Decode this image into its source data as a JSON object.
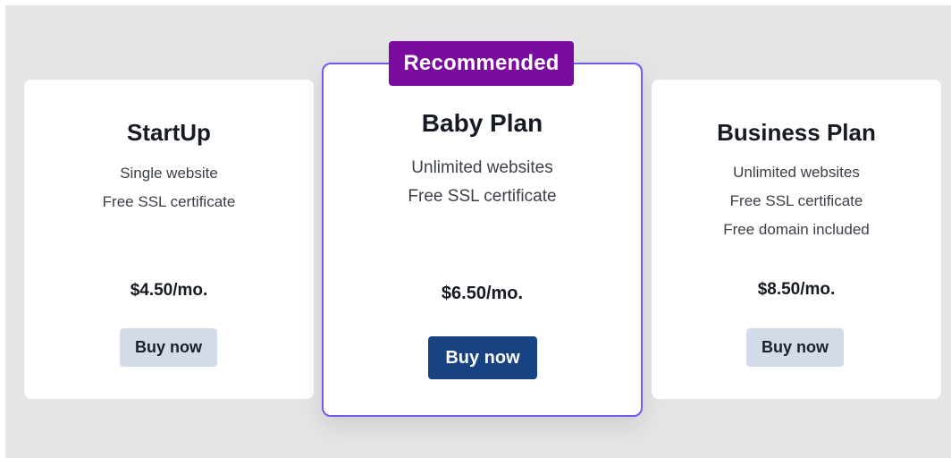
{
  "featured_badge": "Recommended",
  "plans": [
    {
      "title": "StartUp",
      "features": [
        "Single website",
        "Free SSL certificate"
      ],
      "price": "$4.50/mo.",
      "button": "Buy now"
    },
    {
      "title": "Baby Plan",
      "features": [
        "Unlimited websites",
        "Free SSL certificate"
      ],
      "price": "$6.50/mo.",
      "button": "Buy now"
    },
    {
      "title": "Business Plan",
      "features": [
        "Unlimited websites",
        "Free SSL certificate",
        "Free domain included"
      ],
      "price": "$8.50/mo.",
      "button": "Buy now"
    }
  ],
  "colors": {
    "background": "#e5e5e5",
    "card": "#ffffff",
    "badge": "#7a0b9f",
    "featured_border": "#6e5bf0",
    "primary_button": "#174382",
    "secondary_button": "#d3dbe9"
  }
}
